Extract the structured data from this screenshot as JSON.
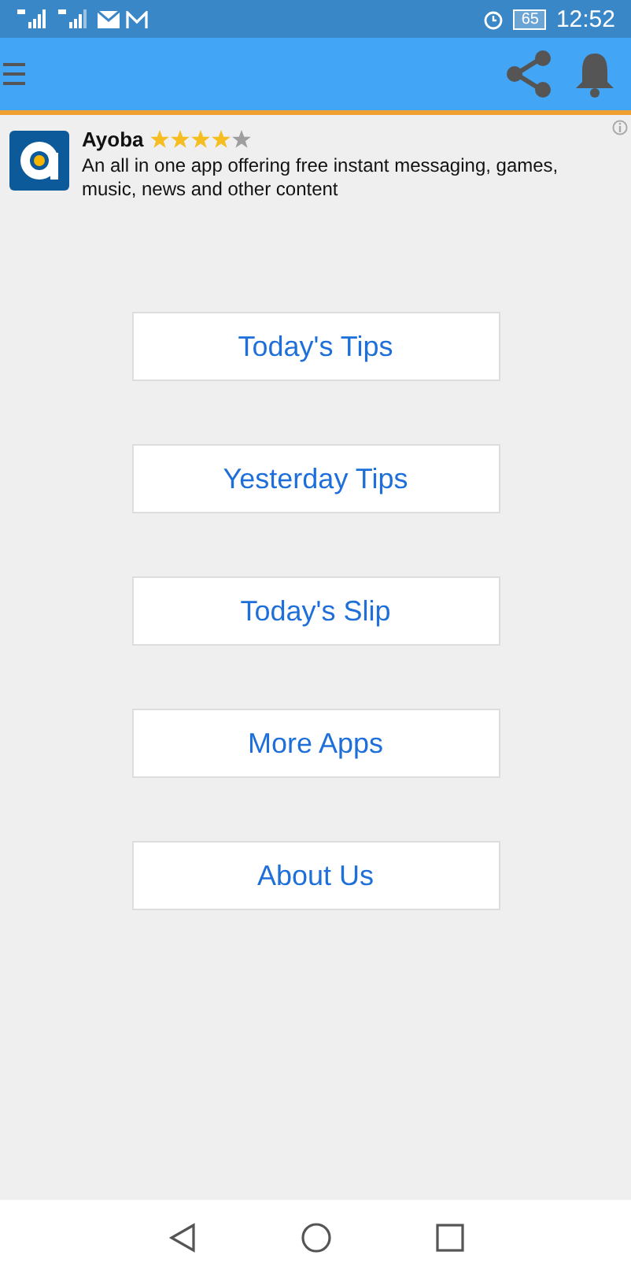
{
  "status_bar": {
    "battery": "65",
    "time": "12:52"
  },
  "ad": {
    "name": "Ayoba",
    "stars": 4,
    "description": "An all in one app offering free instant messaging, games, music, news and other content"
  },
  "buttons": [
    "Today's Tips",
    "Yesterday Tips",
    "Today's Slip",
    "More Apps",
    "About Us"
  ]
}
